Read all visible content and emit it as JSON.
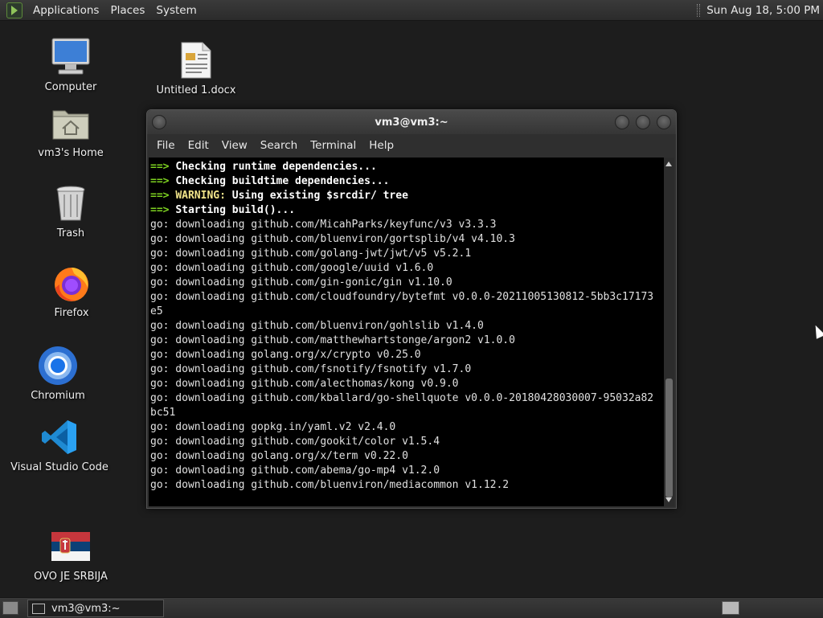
{
  "top_panel": {
    "menus": [
      "Applications",
      "Places",
      "System"
    ],
    "clock": "Sun Aug 18,  5:00 PM"
  },
  "desktop_icons": [
    {
      "label": "Computer",
      "icon": "computer-icon"
    },
    {
      "label": "Untitled 1.docx",
      "icon": "document-icon"
    },
    {
      "label": "vm3's Home",
      "icon": "home-folder-icon"
    },
    {
      "label": "Trash",
      "icon": "trash-icon"
    },
    {
      "label": "Firefox",
      "icon": "firefox-icon"
    },
    {
      "label": "Chromium",
      "icon": "chromium-icon"
    },
    {
      "label": "Visual Studio Code",
      "icon": "vscode-icon"
    },
    {
      "label": "OVO JE SRBIJA",
      "icon": "serbia-flag-icon"
    }
  ],
  "terminal": {
    "title": "vm3@vm3:~",
    "menus": [
      "File",
      "Edit",
      "View",
      "Search",
      "Terminal",
      "Help"
    ],
    "lines": [
      {
        "prefix": "==> ",
        "text": "Checking runtime dependencies...",
        "style": "bold"
      },
      {
        "prefix": "==> ",
        "text": "Checking buildtime dependencies...",
        "style": "bold"
      },
      {
        "prefix": "==> ",
        "text": "WARNING:",
        "rest": " Using existing $srcdir/ tree",
        "style": "warn"
      },
      {
        "prefix": "==> ",
        "text": "Starting build()...",
        "style": "bold"
      },
      {
        "text": "go: downloading github.com/MicahParks/keyfunc/v3 v3.3.3"
      },
      {
        "text": "go: downloading github.com/bluenviron/gortsplib/v4 v4.10.3"
      },
      {
        "text": "go: downloading github.com/golang-jwt/jwt/v5 v5.2.1"
      },
      {
        "text": "go: downloading github.com/google/uuid v1.6.0"
      },
      {
        "text": "go: downloading github.com/gin-gonic/gin v1.10.0"
      },
      {
        "text": "go: downloading github.com/cloudfoundry/bytefmt v0.0.0-20211005130812-5bb3c17173"
      },
      {
        "text": "e5"
      },
      {
        "text": "go: downloading github.com/bluenviron/gohlslib v1.4.0"
      },
      {
        "text": "go: downloading github.com/matthewhartstonge/argon2 v1.0.0"
      },
      {
        "text": "go: downloading golang.org/x/crypto v0.25.0"
      },
      {
        "text": "go: downloading github.com/fsnotify/fsnotify v1.7.0"
      },
      {
        "text": "go: downloading github.com/alecthomas/kong v0.9.0"
      },
      {
        "text": "go: downloading github.com/kballard/go-shellquote v0.0.0-20180428030007-95032a82"
      },
      {
        "text": "bc51"
      },
      {
        "text": "go: downloading gopkg.in/yaml.v2 v2.4.0"
      },
      {
        "text": "go: downloading github.com/gookit/color v1.5.4"
      },
      {
        "text": "go: downloading golang.org/x/term v0.22.0"
      },
      {
        "text": "go: downloading github.com/abema/go-mp4 v1.2.0"
      },
      {
        "text": "go: downloading github.com/bluenviron/mediacommon v1.12.2"
      }
    ]
  },
  "taskbar": {
    "window_button": "vm3@vm3:~"
  }
}
